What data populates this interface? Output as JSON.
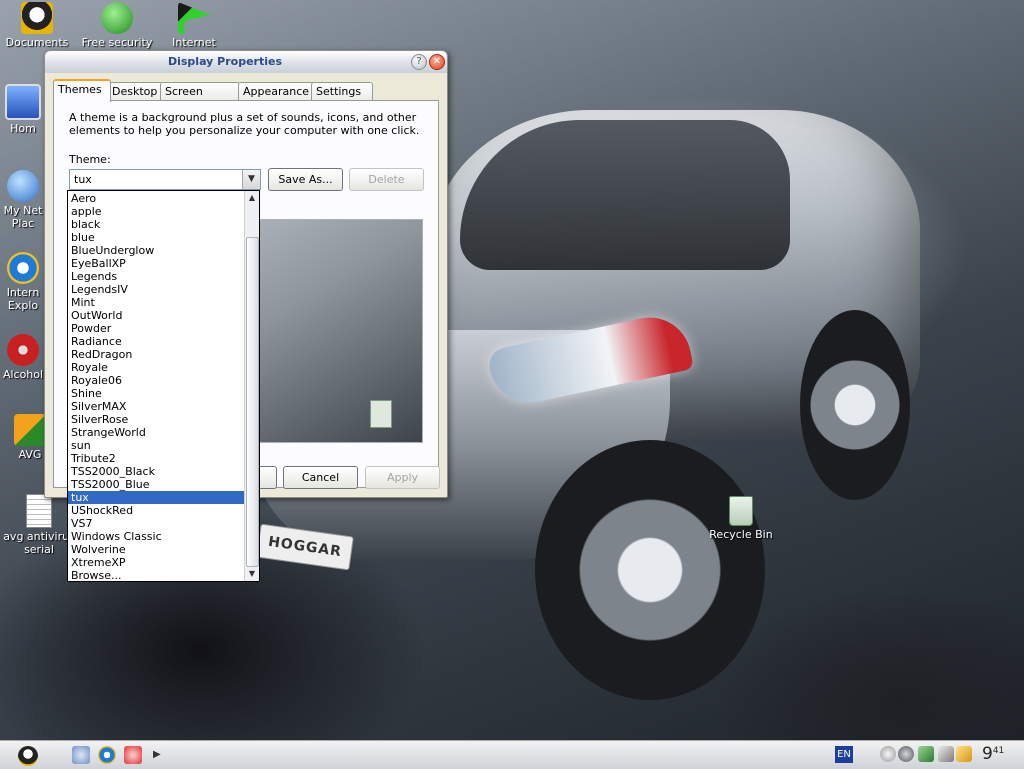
{
  "desktop": {
    "icons": [
      {
        "label": "Documents"
      },
      {
        "label": "Free security"
      },
      {
        "label": "Internet"
      },
      {
        "label": "Hom"
      },
      {
        "label": "My Net"
      },
      {
        "label": "Plac"
      },
      {
        "label": "Intern"
      },
      {
        "label": "Explo"
      },
      {
        "label": "Alcohol"
      },
      {
        "label": "AVG"
      },
      {
        "label": "avg antivirus"
      },
      {
        "label": "serial"
      },
      {
        "label": "Recycle Bin"
      }
    ],
    "plate_text": "HOGGAR"
  },
  "dialog": {
    "title": "Display Properties",
    "help_glyph": "?",
    "close_glyph": "✕",
    "tabs": [
      {
        "label": "Themes"
      },
      {
        "label": "Desktop"
      },
      {
        "label": "Screen Saver"
      },
      {
        "label": "Appearance"
      },
      {
        "label": "Settings"
      }
    ],
    "active_tab": "Themes",
    "description": "A theme is a background plus a set of sounds, icons, and other elements to help you personalize your computer with one click.",
    "theme_label": "Theme:",
    "theme_value": "tux",
    "save_as_label": "Save As...",
    "delete_label": "Delete",
    "cancel_label": "Cancel",
    "apply_label": "Apply"
  },
  "dropdown": {
    "items": [
      "Aero",
      "apple",
      "black",
      "blue",
      "BlueUnderglow",
      "EyeBallXP",
      "Legends",
      "LegendsIV",
      "Mint",
      "OutWorld",
      "Powder",
      "Radiance",
      "RedDragon",
      "Royale",
      "Royale06",
      "Shine",
      "SilverMAX",
      "SilverRose",
      "StrangeWorld",
      "sun",
      "Tribute2",
      "TSS2000_Black",
      "TSS2000_Blue",
      "tux",
      "UShockRed",
      "VS7",
      "Windows Classic",
      "Wolverine",
      "XtremeXP",
      "Browse..."
    ],
    "selected": "tux"
  },
  "taskbar": {
    "language": "EN",
    "clock_hour": "9",
    "clock_minute": "41"
  }
}
